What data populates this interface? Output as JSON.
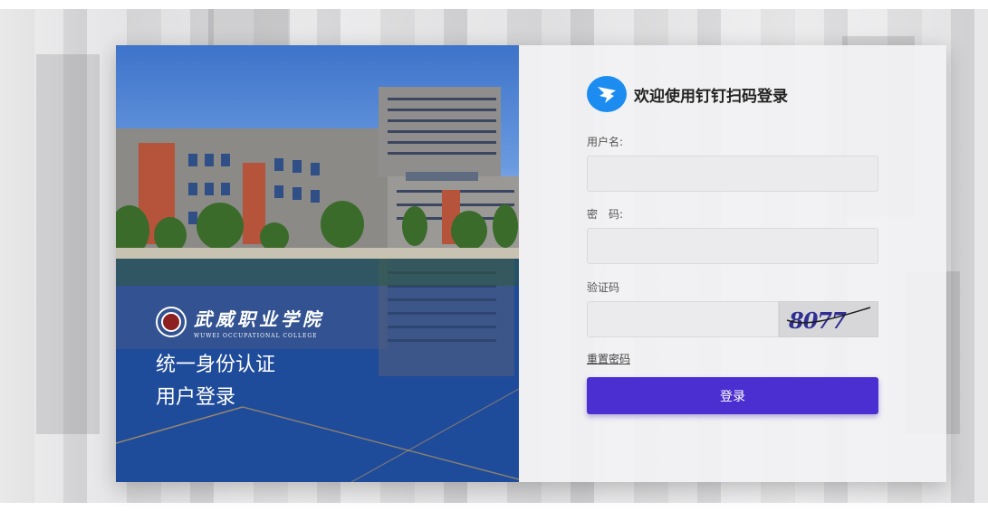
{
  "header": {
    "title": "欢迎使用钉钉扫码登录",
    "icon": "dingtalk-icon"
  },
  "left_panel": {
    "college_name_cn": "武威职业学院",
    "college_name_en": "WUWEI OCCUPATIONAL COLLEGE",
    "slogan_line1": "统一身份认证",
    "slogan_line2": "用户登录"
  },
  "form": {
    "username_label": "用户名:",
    "username_value": "",
    "password_label": "密　码:",
    "password_value": "",
    "captcha_label": "验证码",
    "captcha_value": "",
    "captcha_image_text": "8077",
    "reset_password_label": "重置密码",
    "login_button_label": "登录"
  },
  "colors": {
    "primary_button": "#4b2fd0",
    "dingtalk_blue": "#1c8cf0"
  }
}
